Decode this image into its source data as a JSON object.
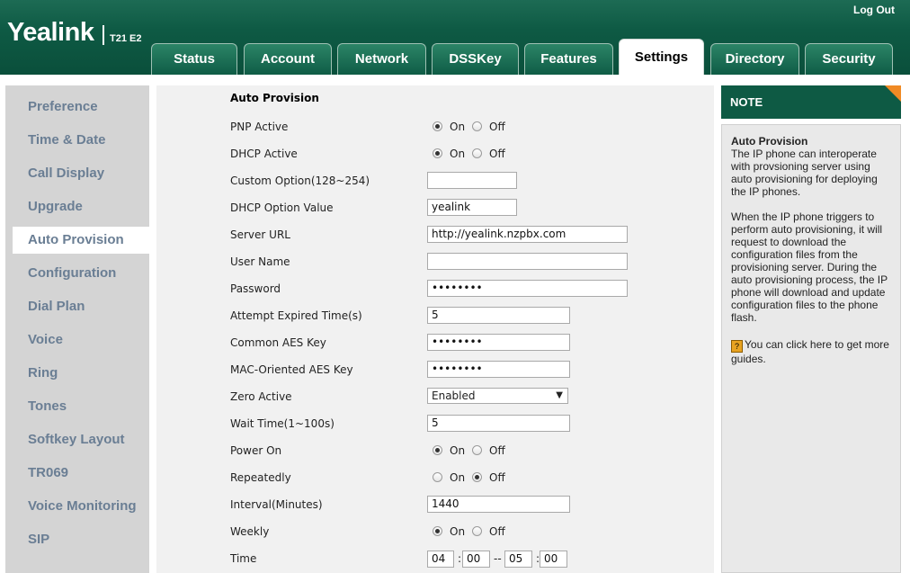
{
  "header": {
    "brand": "Yealink",
    "model": "T21 E2",
    "logout": "Log Out",
    "tabs": [
      "Status",
      "Account",
      "Network",
      "DSSKey",
      "Features",
      "Settings",
      "Directory",
      "Security"
    ],
    "active_tab": "Settings"
  },
  "sidebar": {
    "items": [
      "Preference",
      "Time & Date",
      "Call Display",
      "Upgrade",
      "Auto Provision",
      "Configuration",
      "Dial Plan",
      "Voice",
      "Ring",
      "Tones",
      "Softkey Layout",
      "TR069",
      "Voice Monitoring",
      "SIP"
    ],
    "active": "Auto Provision"
  },
  "form": {
    "title": "Auto Provision",
    "on_label": "On",
    "off_label": "Off",
    "pnp_active": {
      "label": "PNP Active",
      "value": "On"
    },
    "dhcp_active": {
      "label": "DHCP Active",
      "value": "On"
    },
    "custom_option": {
      "label": "Custom Option(128~254)",
      "value": ""
    },
    "dhcp_option_value": {
      "label": "DHCP Option Value",
      "value": "yealink"
    },
    "server_url": {
      "label": "Server URL",
      "value": "http://yealink.nzpbx.com"
    },
    "user_name": {
      "label": "User Name",
      "value": ""
    },
    "password": {
      "label": "Password",
      "value": "••••••••"
    },
    "attempt_expired_time": {
      "label": "Attempt Expired Time(s)",
      "value": "5"
    },
    "common_aes_key": {
      "label": "Common AES Key",
      "value": "••••••••"
    },
    "mac_aes_key": {
      "label": "MAC-Oriented AES Key",
      "value": "••••••••"
    },
    "zero_active": {
      "label": "Zero Active",
      "value": "Enabled"
    },
    "wait_time": {
      "label": "Wait Time(1~100s)",
      "value": "5"
    },
    "power_on": {
      "label": "Power On",
      "value": "On"
    },
    "repeatedly": {
      "label": "Repeatedly",
      "value": "Off"
    },
    "interval": {
      "label": "Interval(Minutes)",
      "value": "1440"
    },
    "weekly": {
      "label": "Weekly",
      "value": "On"
    },
    "time": {
      "label": "Time",
      "start_hour": "04",
      "start_min": "00",
      "end_hour": "05",
      "end_min": "00",
      "colon": ":",
      "dash": "--"
    }
  },
  "note": {
    "header": "NOTE",
    "title": "Auto Provision",
    "para1": "The IP phone can interoperate with provsioning server using auto provisioning for deploying the IP phones.",
    "para2": "When the IP phone triggers to perform auto provisioning, it will request to download the configuration files from the provisioning server. During the auto provisioning process, the IP phone will download and update configuration files to the phone flash.",
    "guide_icon": "?",
    "guide": "You can click here to get more guides."
  },
  "colors": {
    "header_green": "#0e5a44",
    "nav_text": "#6a7e94",
    "note_corner": "#f08a24"
  }
}
